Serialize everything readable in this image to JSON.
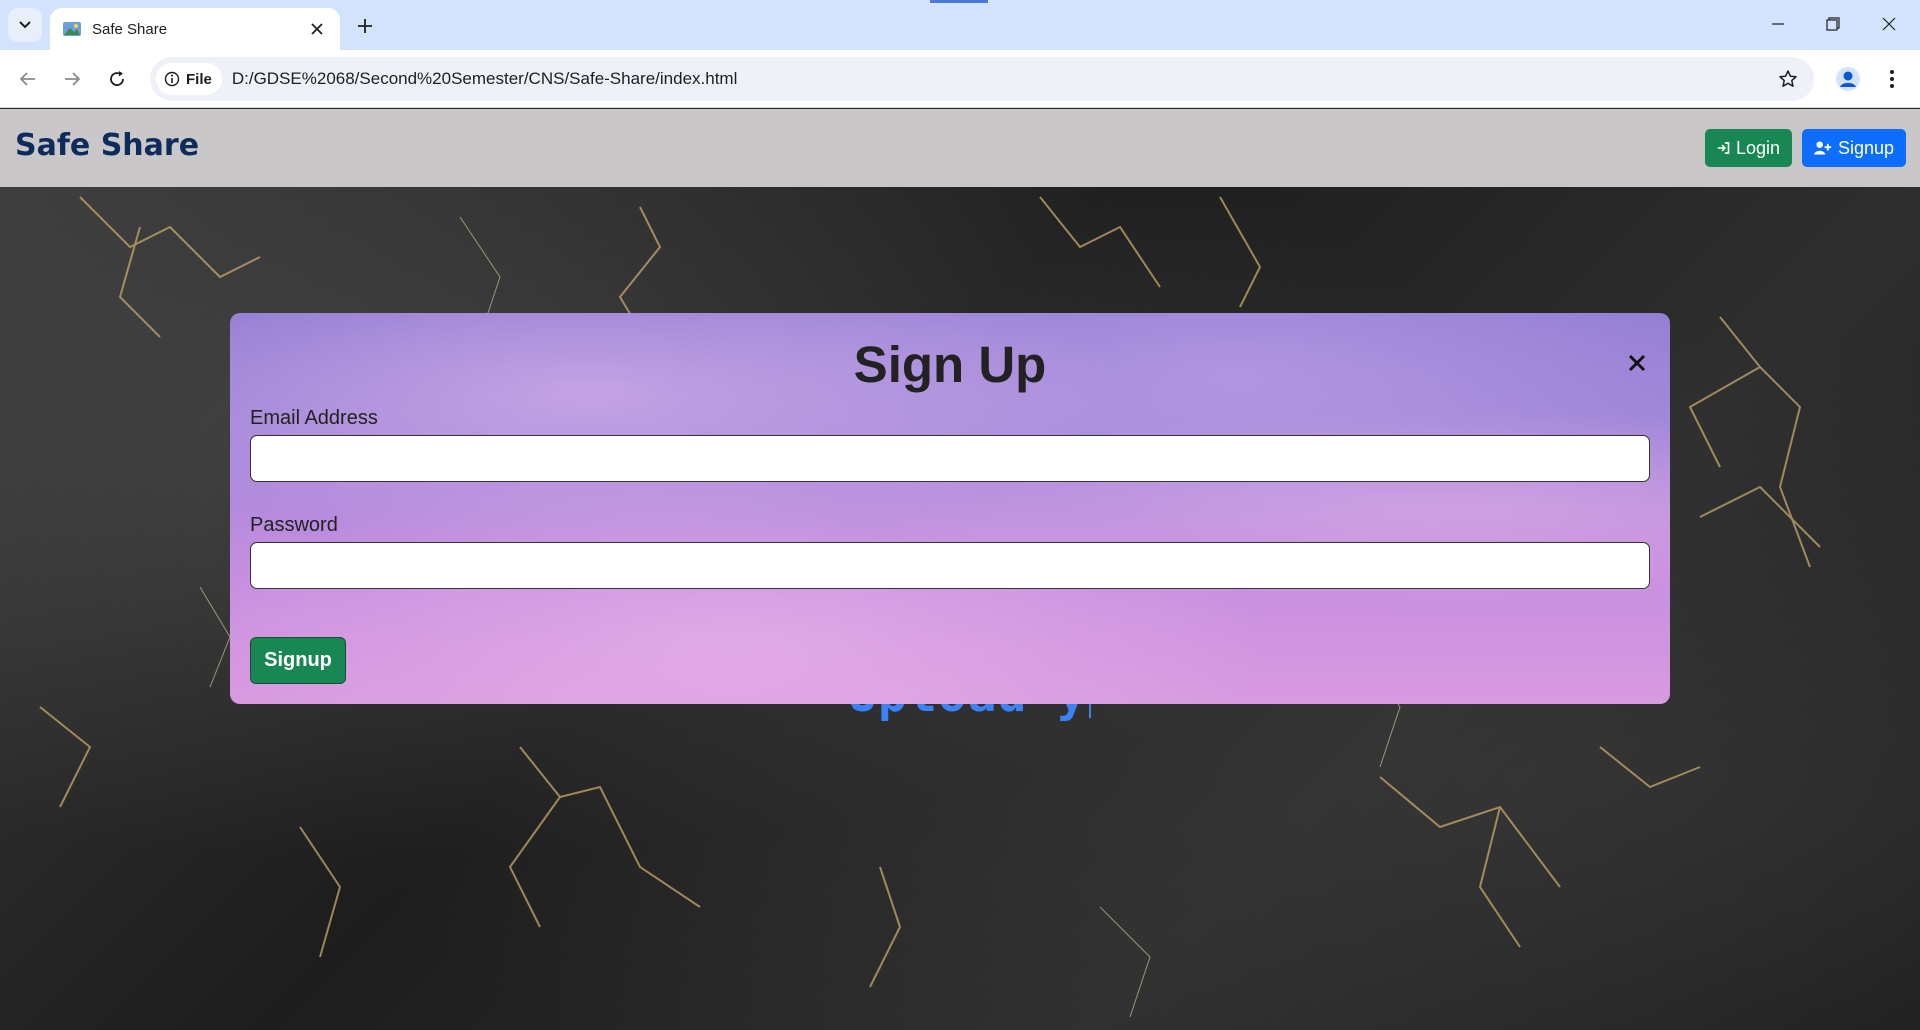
{
  "browser": {
    "tab_title": "Safe Share",
    "url": "D:/GDSE%2068/Second%20Semester/CNS/Safe-Share/index.html",
    "site_chip": "File"
  },
  "navbar": {
    "brand": "Safe Share",
    "login_label": "Login",
    "signup_label": "Signup"
  },
  "hero": {
    "typing_text": "Upload y"
  },
  "modal": {
    "title": "Sign Up",
    "email_label": "Email Address",
    "email_value": "",
    "password_label": "Password",
    "password_value": "",
    "submit_label": "Signup"
  },
  "colors": {
    "brand": "#0d2c5b",
    "login_button": "#198754",
    "signup_button": "#0d6efd",
    "navbar_bg": "#c9c7c8",
    "tabstrip_bg": "#d3e3fd",
    "typing_text": "#3b82f6"
  },
  "icons": {
    "tab_search": "chevron-down-icon",
    "favicon": "image-icon",
    "tab_close": "close-icon",
    "new_tab": "plus-icon",
    "back": "arrow-left-icon",
    "forward": "arrow-right-icon",
    "reload": "reload-icon",
    "site_info": "info-icon",
    "bookmark": "star-icon",
    "profile": "person-icon",
    "menu": "kebab-menu-icon",
    "login": "sign-in-icon",
    "signup": "user-plus-icon",
    "modal_close": "close-icon"
  }
}
